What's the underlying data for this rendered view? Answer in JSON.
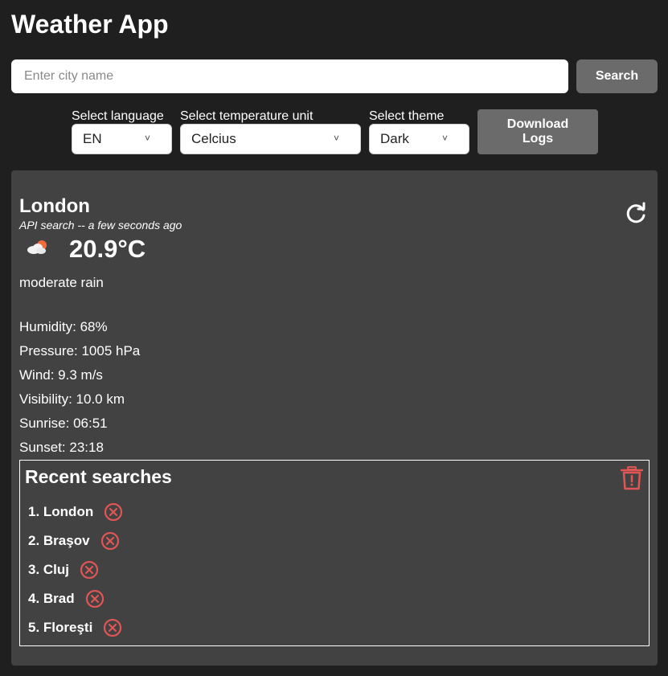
{
  "app": {
    "title": "Weather App"
  },
  "search": {
    "placeholder": "Enter city name",
    "value": "",
    "button_label": "Search"
  },
  "controls": {
    "language": {
      "label": "Select language",
      "selected": "EN"
    },
    "unit": {
      "label": "Select temperature unit",
      "selected": "Celcius"
    },
    "theme": {
      "label": "Select theme",
      "selected": "Dark"
    },
    "download_label": "Download Logs"
  },
  "weather": {
    "city": "London",
    "source": "API search -- a few seconds ago",
    "temperature": "20.9°C",
    "description": "moderate rain",
    "icon": "partly-cloudy-icon",
    "details": {
      "humidity": "Humidity: 68%",
      "pressure": "Pressure: 1005 hPa",
      "wind": "Wind: 9.3 m/s",
      "visibility": "Visibility: 10.0 km",
      "sunrise": "Sunrise: 06:51",
      "sunset": "Sunset: 23:18"
    }
  },
  "recent": {
    "title": "Recent searches",
    "items": [
      "1. London",
      "2. Braşov",
      "3. Cluj",
      "4. Brad",
      "5. Floreşti"
    ]
  },
  "colors": {
    "background": "#1f1f1f",
    "card": "#424242",
    "button": "#6b6b6b",
    "danger": "#e05555",
    "text": "#ffffff"
  }
}
